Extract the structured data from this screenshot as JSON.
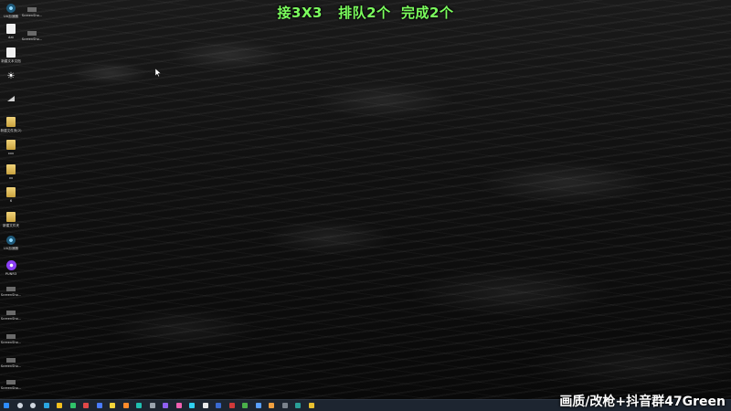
{
  "overlay": {
    "title": "接3X3   排队2个  完成2个",
    "watermark": "画质/改枪+抖音群47Green"
  },
  "desktop": {
    "icons": [
      {
        "name": "desktop-icon-app-1",
        "label": "UU加速器",
        "icon": "round-app"
      },
      {
        "name": "desktop-icon-dat",
        "label": "dat",
        "icon": "file"
      },
      {
        "name": "desktop-icon-new-text",
        "label": "新建文本文档",
        "icon": "file"
      },
      {
        "name": "desktop-icon-sun",
        "label": "",
        "icon": "sun-icon"
      },
      {
        "name": "desktop-icon-signal",
        "label": "",
        "icon": "signal-icon"
      },
      {
        "name": "desktop-icon-folder-1",
        "label": "新建文件夹(2)",
        "icon": "folder"
      },
      {
        "name": "desktop-icon-folder-2",
        "label": "xxx",
        "icon": "folder"
      },
      {
        "name": "desktop-icon-folder-3",
        "label": "xx",
        "icon": "folder"
      },
      {
        "name": "desktop-icon-folder-4",
        "label": "6",
        "icon": "folder"
      },
      {
        "name": "desktop-icon-folder-5",
        "label": "新建文件夹",
        "icon": "folder"
      },
      {
        "name": "desktop-icon-app-2",
        "label": "UU加速器",
        "icon": "round-app"
      },
      {
        "name": "desktop-icon-purple-app",
        "label": "PUNR3",
        "icon": "purple"
      },
      {
        "name": "desktop-icon-shot-a",
        "label": "ScreenSho...",
        "icon": "shot"
      },
      {
        "name": "desktop-icon-shot-b",
        "label": "ScreenSho...",
        "icon": "shot"
      },
      {
        "name": "desktop-icon-shot-c",
        "label": "ScreenSho...",
        "icon": "shot"
      },
      {
        "name": "desktop-icon-shot-d",
        "label": "ScreenSho...",
        "icon": "shot"
      },
      {
        "name": "desktop-icon-shot-e",
        "label": "ScreenSho...",
        "icon": "shot"
      },
      {
        "name": "desktop-icon-shot-f",
        "label": "ScreenSho...",
        "icon": "shot"
      },
      {
        "name": "desktop-icon-shot-g",
        "label": "ScreenSho...",
        "icon": "shot"
      }
    ],
    "column2": [
      {
        "name": "desktop-icon-shot-top",
        "label": "ScreenSho...",
        "icon": "shot"
      },
      {
        "name": "desktop-icon-shot-top2",
        "label": "ScreenSho...",
        "icon": "shot"
      }
    ]
  },
  "taskbar": {
    "items": [
      "start",
      "search",
      "task-view",
      "edge",
      "chrome",
      "app-green",
      "app-red",
      "app-blue",
      "app-yellow",
      "app-orange",
      "app-teal",
      "app-gray",
      "app-purple",
      "app-pink",
      "app-cyan",
      "app-white",
      "app-blue2",
      "app-red2",
      "app-green2",
      "app-blue3",
      "app-orange2",
      "app-gray2",
      "app-teal2",
      "app-yellow2"
    ],
    "colors": {
      "start": "#2e8cff",
      "search": "#cfd6df",
      "task-view": "#cfd6df",
      "edge": "#2aa5e0",
      "chrome": "#f4c01e",
      "app-green": "#30c26a",
      "app-red": "#e04848",
      "app-blue": "#4a7cff",
      "app-yellow": "#f2d43a",
      "app-orange": "#ff8a2a",
      "app-teal": "#20c0b0",
      "app-gray": "#9aa3ad",
      "app-purple": "#9060f0",
      "app-pink": "#f060b0",
      "app-cyan": "#30d0f0",
      "app-white": "#e8e8e8",
      "app-blue2": "#3a6ad0",
      "app-red2": "#d03a3a",
      "app-green2": "#4ab04a",
      "app-blue3": "#5aa0ff",
      "app-orange2": "#f0a040",
      "app-gray2": "#7a828c",
      "app-teal2": "#2aa098",
      "app-yellow2": "#e8c030"
    }
  }
}
